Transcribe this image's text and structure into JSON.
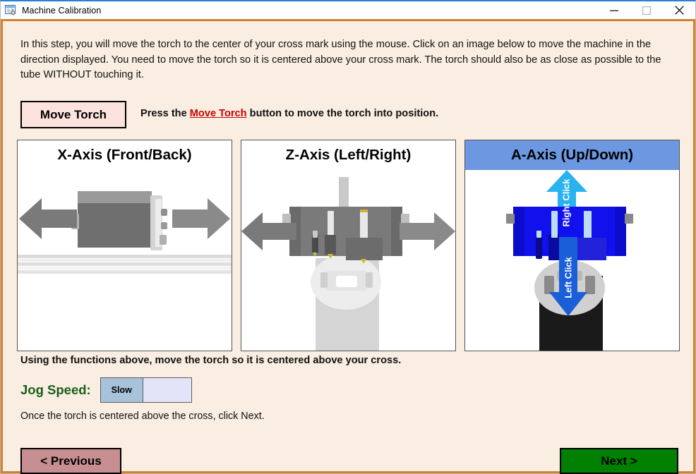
{
  "window": {
    "title": "Machine Calibration",
    "icon": "machine-settings-icon",
    "minimize_label": "—",
    "maximize_label": "□",
    "close_label": "✕",
    "border_color": "#d2822e",
    "background_color": "#faeee2"
  },
  "intro": {
    "text": "In this step, you will move the torch to the center of your cross mark using the mouse. Click on an image below to move the machine in the direction displayed. You need to move the torch so it is centered above your cross mark. The torch should also be as close as possible to the tube WITHOUT touching it."
  },
  "torch": {
    "button_label": "Move Torch",
    "button_color": "#fde3dd",
    "hint_prefix": "Press the ",
    "hint_highlight": "Move Torch",
    "hint_suffix": " button to move the torch into position.",
    "highlight_color": "#cc0000"
  },
  "panels": [
    {
      "id": "x",
      "title": "X-Axis (Front/Back)",
      "selected": false,
      "arrow_color": "#7a7a7a",
      "arrow_left": "left-arrow-icon",
      "arrow_right": "right-arrow-icon"
    },
    {
      "id": "z",
      "title": "Z-Axis (Left/Right)",
      "selected": false,
      "arrow_color": "#7a7a7a",
      "arrow_left": "left-arrow-icon",
      "arrow_right": "right-arrow-icon"
    },
    {
      "id": "a",
      "title": "A-Axis (Up/Down)",
      "selected": true,
      "header_color": "#6b98e0",
      "up_arrow_label": "Right Click",
      "down_arrow_label": "Left Click",
      "up_arrow_color": "#29b2f0",
      "down_arrow_color": "#1a5fd8"
    }
  ],
  "caption": {
    "text": "Using the functions above, move the torch so it is centered above your cross."
  },
  "jog": {
    "label": "Jog Speed:",
    "label_color": "#1a5c1a",
    "selected_option": "Slow",
    "options": [
      "Slow"
    ]
  },
  "footnote": {
    "text": "Once the torch is centered above the cross, click Next."
  },
  "nav": {
    "previous_label": "< Previous",
    "previous_color": "#c78e92",
    "next_label": "Next >",
    "next_color": "#018001"
  }
}
